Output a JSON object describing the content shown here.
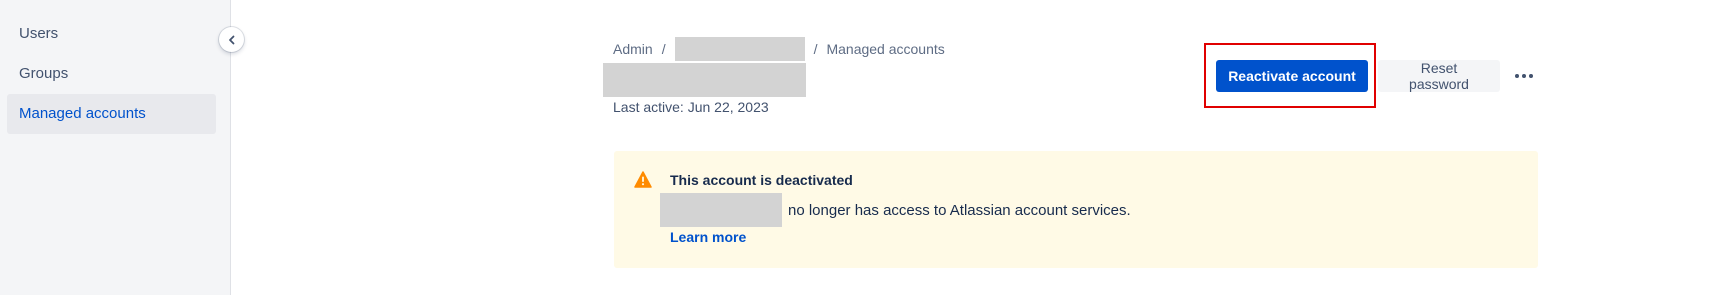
{
  "sidebar": {
    "items": [
      {
        "label": "Users"
      },
      {
        "label": "Groups"
      },
      {
        "label": "Managed accounts"
      }
    ],
    "active_index": 2,
    "collapse_icon": "chevron-left-icon"
  },
  "breadcrumb": {
    "items": [
      "Admin",
      "Managed accounts"
    ],
    "separator": "/"
  },
  "profile": {
    "last_active": "Last active: Jun 22, 2023"
  },
  "actions": {
    "reactivate_label": "Reactivate account",
    "reset_password_label": "Reset password",
    "more_icon": "more-horizontal-icon"
  },
  "banner": {
    "title": "This account is deactivated",
    "message": "no longer has access to Atlassian account services.",
    "link": "Learn more",
    "icon": "warning-icon"
  },
  "colors": {
    "primary": "#0052cc",
    "warning_bg": "#fffae6",
    "warning_icon": "#ff8b00",
    "highlight": "#e00000"
  }
}
